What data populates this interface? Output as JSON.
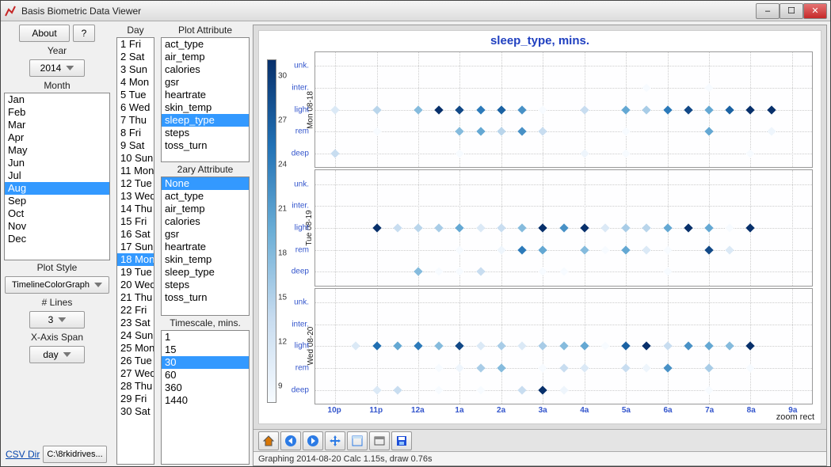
{
  "window": {
    "title": "Basis Biometric Data Viewer"
  },
  "win_controls": {
    "min": "–",
    "max": "☐",
    "close": "✕"
  },
  "controls": {
    "about": "About",
    "help": "?",
    "year_label": "Year",
    "year_value": "2014",
    "month_label": "Month",
    "months": [
      "Jan",
      "Feb",
      "Mar",
      "Apr",
      "May",
      "Jun",
      "Jul",
      "Aug",
      "Sep",
      "Oct",
      "Nov",
      "Dec"
    ],
    "month_selected": "Aug",
    "plot_style_label": "Plot Style",
    "plot_style_value": "TimelineColorGraph",
    "nlines_label": "# Lines",
    "nlines_value": "3",
    "xspan_label": "X-Axis Span",
    "xspan_value": "day",
    "csv_link": "CSV Dir",
    "csv_path": "C:\\8rkidrives..."
  },
  "day": {
    "label": "Day",
    "items": [
      "1 Fri",
      "2 Sat",
      "3 Sun",
      "4 Mon",
      "5 Tue",
      "6 Wed",
      "7 Thu",
      "8 Fri",
      "9 Sat",
      "10 Sun",
      "11 Mon",
      "12 Tue",
      "13 Wed",
      "14 Thu",
      "15 Fri",
      "16 Sat",
      "17 Sun",
      "18 Mon",
      "19 Tue",
      "20 Wed",
      "21 Thu",
      "22 Fri",
      "23 Sat",
      "24 Sun",
      "25 Mon",
      "26 Tue",
      "27 Wed",
      "28 Thu",
      "29 Fri",
      "30 Sat"
    ],
    "selected": "18 Mon"
  },
  "plot_attr": {
    "label": "Plot Attribute",
    "items": [
      "act_type",
      "air_temp",
      "calories",
      "gsr",
      "heartrate",
      "skin_temp",
      "sleep_type",
      "steps",
      "toss_turn"
    ],
    "selected": "sleep_type"
  },
  "ary_attr": {
    "label": "2ary Attribute",
    "items": [
      "None",
      "act_type",
      "air_temp",
      "calories",
      "gsr",
      "heartrate",
      "skin_temp",
      "sleep_type",
      "steps",
      "toss_turn"
    ],
    "selected": "None"
  },
  "timescale": {
    "label": "Timescale, mins.",
    "items": [
      "1",
      "15",
      "30",
      "60",
      "360",
      "1440"
    ],
    "selected": "30"
  },
  "chart": {
    "title": "sleep_type, mins.",
    "status": "Graphing 2014-08-20 Calc 1.15s, draw 0.76s",
    "zoom_mode": "zoom rect"
  },
  "chart_data": {
    "type": "scatter",
    "xlabel": "",
    "ylabel_per_panel": [
      "Mon 08-18",
      "Tue 08-19",
      "Wed 08-20"
    ],
    "categories": [
      "deep",
      "rem",
      "light",
      "inter.",
      "unk."
    ],
    "x_ticks": [
      "10p",
      "11p",
      "12a",
      "1a",
      "2a",
      "3a",
      "4a",
      "5a",
      "6a",
      "7a",
      "8a",
      "9a"
    ],
    "colorbar": {
      "min": 9,
      "max": 30,
      "ticks": [
        30,
        27,
        24,
        21,
        18,
        15,
        12,
        9
      ]
    },
    "panels": [
      {
        "name": "Mon 08-18",
        "points": [
          {
            "x": "10p",
            "cat": "light",
            "v": 12
          },
          {
            "x": "10p",
            "cat": "deep",
            "v": 14
          },
          {
            "x": "11p",
            "cat": "light",
            "v": 15
          },
          {
            "x": "11p",
            "cat": "rem",
            "v": 9
          },
          {
            "x": "12a",
            "cat": "light",
            "v": 18
          },
          {
            "x": "12.5a",
            "cat": "light",
            "v": 30
          },
          {
            "x": "1a",
            "cat": "light",
            "v": 28
          },
          {
            "x": "1a",
            "cat": "rem",
            "v": 18
          },
          {
            "x": "1a",
            "cat": "deep",
            "v": 9
          },
          {
            "x": "1.5a",
            "cat": "light",
            "v": 24
          },
          {
            "x": "1.5a",
            "cat": "rem",
            "v": 20
          },
          {
            "x": "2a",
            "cat": "light",
            "v": 26
          },
          {
            "x": "2a",
            "cat": "rem",
            "v": 15
          },
          {
            "x": "2.5a",
            "cat": "light",
            "v": 22
          },
          {
            "x": "2.5a",
            "cat": "rem",
            "v": 22
          },
          {
            "x": "3a",
            "cat": "light",
            "v": 9
          },
          {
            "x": "3a",
            "cat": "rem",
            "v": 14
          },
          {
            "x": "4a",
            "cat": "light",
            "v": 14
          },
          {
            "x": "4a",
            "cat": "deep",
            "v": 10
          },
          {
            "x": "5a",
            "cat": "light",
            "v": 20
          },
          {
            "x": "5a",
            "cat": "rem",
            "v": 9
          },
          {
            "x": "5a",
            "cat": "deep",
            "v": 9
          },
          {
            "x": "5.5a",
            "cat": "light",
            "v": 16
          },
          {
            "x": "5.5a",
            "cat": "inter.",
            "v": 9
          },
          {
            "x": "6a",
            "cat": "light",
            "v": 24
          },
          {
            "x": "6.5a",
            "cat": "light",
            "v": 28
          },
          {
            "x": "7a",
            "cat": "light",
            "v": 20
          },
          {
            "x": "7a",
            "cat": "rem",
            "v": 20
          },
          {
            "x": "7a",
            "cat": "inter.",
            "v": 9
          },
          {
            "x": "7.5a",
            "cat": "light",
            "v": 26
          },
          {
            "x": "8a",
            "cat": "light",
            "v": 30
          },
          {
            "x": "8a",
            "cat": "deep",
            "v": 9
          },
          {
            "x": "8.5a",
            "cat": "light",
            "v": 30
          },
          {
            "x": "8.5a",
            "cat": "rem",
            "v": 10
          }
        ]
      },
      {
        "name": "Tue 08-19",
        "points": [
          {
            "x": "11p",
            "cat": "light",
            "v": 30
          },
          {
            "x": "11.5p",
            "cat": "light",
            "v": 14
          },
          {
            "x": "12a",
            "cat": "light",
            "v": 15
          },
          {
            "x": "12a",
            "cat": "deep",
            "v": 18
          },
          {
            "x": "12.5a",
            "cat": "light",
            "v": 16
          },
          {
            "x": "12.5a",
            "cat": "deep",
            "v": 9
          },
          {
            "x": "1a",
            "cat": "light",
            "v": 20
          },
          {
            "x": "1a",
            "cat": "rem",
            "v": 9
          },
          {
            "x": "1a",
            "cat": "deep",
            "v": 9
          },
          {
            "x": "1.5a",
            "cat": "light",
            "v": 12
          },
          {
            "x": "1.5a",
            "cat": "deep",
            "v": 14
          },
          {
            "x": "2a",
            "cat": "light",
            "v": 14
          },
          {
            "x": "2a",
            "cat": "rem",
            "v": 10
          },
          {
            "x": "2.5a",
            "cat": "light",
            "v": 18
          },
          {
            "x": "2.5a",
            "cat": "rem",
            "v": 24
          },
          {
            "x": "3a",
            "cat": "light",
            "v": 30
          },
          {
            "x": "3a",
            "cat": "rem",
            "v": 20
          },
          {
            "x": "3a",
            "cat": "deep",
            "v": 9
          },
          {
            "x": "3.5a",
            "cat": "light",
            "v": 22
          },
          {
            "x": "3.5a",
            "cat": "deep",
            "v": 9
          },
          {
            "x": "4a",
            "cat": "light",
            "v": 30
          },
          {
            "x": "4a",
            "cat": "rem",
            "v": 18
          },
          {
            "x": "4.5a",
            "cat": "light",
            "v": 12
          },
          {
            "x": "4.5a",
            "cat": "rem",
            "v": 9
          },
          {
            "x": "5a",
            "cat": "light",
            "v": 16
          },
          {
            "x": "5a",
            "cat": "rem",
            "v": 20
          },
          {
            "x": "5.5a",
            "cat": "light",
            "v": 15
          },
          {
            "x": "5.5a",
            "cat": "rem",
            "v": 12
          },
          {
            "x": "6a",
            "cat": "light",
            "v": 20
          },
          {
            "x": "6a",
            "cat": "rem",
            "v": 9
          },
          {
            "x": "6a",
            "cat": "deep",
            "v": 9
          },
          {
            "x": "6.5a",
            "cat": "light",
            "v": 30
          },
          {
            "x": "7a",
            "cat": "light",
            "v": 20
          },
          {
            "x": "7a",
            "cat": "rem",
            "v": 28
          },
          {
            "x": "7.5a",
            "cat": "light",
            "v": 9
          },
          {
            "x": "7.5a",
            "cat": "rem",
            "v": 12
          },
          {
            "x": "8a",
            "cat": "light",
            "v": 30
          }
        ]
      },
      {
        "name": "Wed 08-20",
        "points": [
          {
            "x": "10.5p",
            "cat": "light",
            "v": 12
          },
          {
            "x": "11p",
            "cat": "light",
            "v": 25
          },
          {
            "x": "11p",
            "cat": "deep",
            "v": 12
          },
          {
            "x": "11.5p",
            "cat": "light",
            "v": 20
          },
          {
            "x": "11.5p",
            "cat": "deep",
            "v": 14
          },
          {
            "x": "12a",
            "cat": "light",
            "v": 24
          },
          {
            "x": "12.5a",
            "cat": "light",
            "v": 18
          },
          {
            "x": "12.5a",
            "cat": "rem",
            "v": 9
          },
          {
            "x": "12.5a",
            "cat": "deep",
            "v": 9
          },
          {
            "x": "1a",
            "cat": "light",
            "v": 28
          },
          {
            "x": "1a",
            "cat": "rem",
            "v": 10
          },
          {
            "x": "1.5a",
            "cat": "light",
            "v": 12
          },
          {
            "x": "1.5a",
            "cat": "rem",
            "v": 16
          },
          {
            "x": "1.5a",
            "cat": "deep",
            "v": 9
          },
          {
            "x": "2a",
            "cat": "light",
            "v": 16
          },
          {
            "x": "2a",
            "cat": "rem",
            "v": 18
          },
          {
            "x": "2.5a",
            "cat": "light",
            "v": 12
          },
          {
            "x": "2.5a",
            "cat": "deep",
            "v": 14
          },
          {
            "x": "3a",
            "cat": "light",
            "v": 16
          },
          {
            "x": "3a",
            "cat": "rem",
            "v": 9
          },
          {
            "x": "3a",
            "cat": "deep",
            "v": 30
          },
          {
            "x": "3.5a",
            "cat": "light",
            "v": 18
          },
          {
            "x": "3.5a",
            "cat": "rem",
            "v": 14
          },
          {
            "x": "3.5a",
            "cat": "deep",
            "v": 10
          },
          {
            "x": "4a",
            "cat": "light",
            "v": 20
          },
          {
            "x": "4a",
            "cat": "rem",
            "v": 12
          },
          {
            "x": "4.5a",
            "cat": "light",
            "v": 9
          },
          {
            "x": "5a",
            "cat": "light",
            "v": 26
          },
          {
            "x": "5a",
            "cat": "rem",
            "v": 14
          },
          {
            "x": "5.5a",
            "cat": "light",
            "v": 30
          },
          {
            "x": "5.5a",
            "cat": "rem",
            "v": 10
          },
          {
            "x": "6a",
            "cat": "light",
            "v": 14
          },
          {
            "x": "6a",
            "cat": "rem",
            "v": 22
          },
          {
            "x": "6.5a",
            "cat": "light",
            "v": 22
          },
          {
            "x": "7a",
            "cat": "light",
            "v": 20
          },
          {
            "x": "7a",
            "cat": "rem",
            "v": 16
          },
          {
            "x": "7a",
            "cat": "deep",
            "v": 9
          },
          {
            "x": "7.5a",
            "cat": "light",
            "v": 18
          },
          {
            "x": "8a",
            "cat": "light",
            "v": 30
          },
          {
            "x": "8a",
            "cat": "rem",
            "v": 9
          }
        ]
      }
    ]
  }
}
